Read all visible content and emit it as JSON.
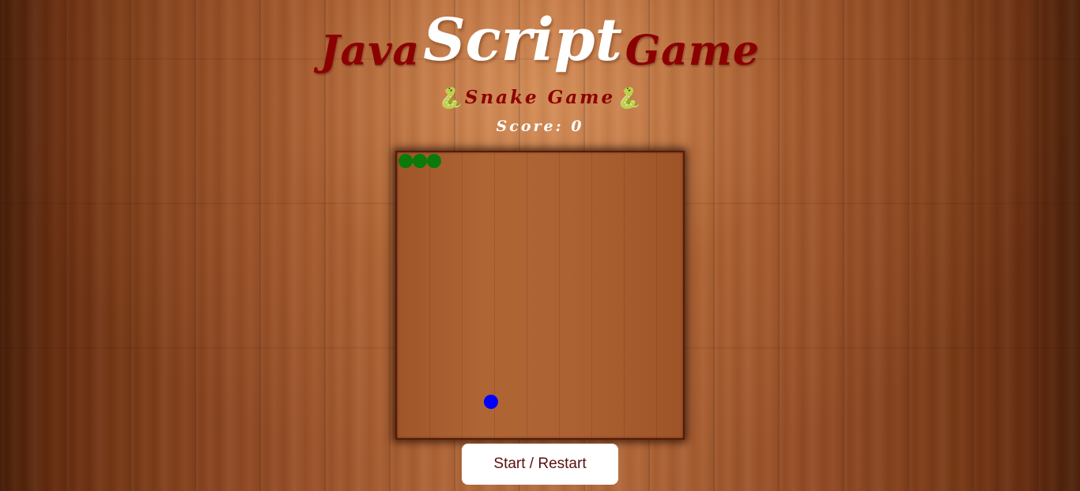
{
  "header": {
    "title_part1": "Java",
    "title_part2": "Script",
    "title_part3": "Game",
    "subtitle_icon": "🐍",
    "subtitle": "Snake Game",
    "score_label": "Score:",
    "score_value": "0"
  },
  "game": {
    "snake_color": "#0a7a0a",
    "food_color": "#0000ff",
    "snake_segment_count": 3
  },
  "controls": {
    "start_label": "Start / Restart"
  }
}
